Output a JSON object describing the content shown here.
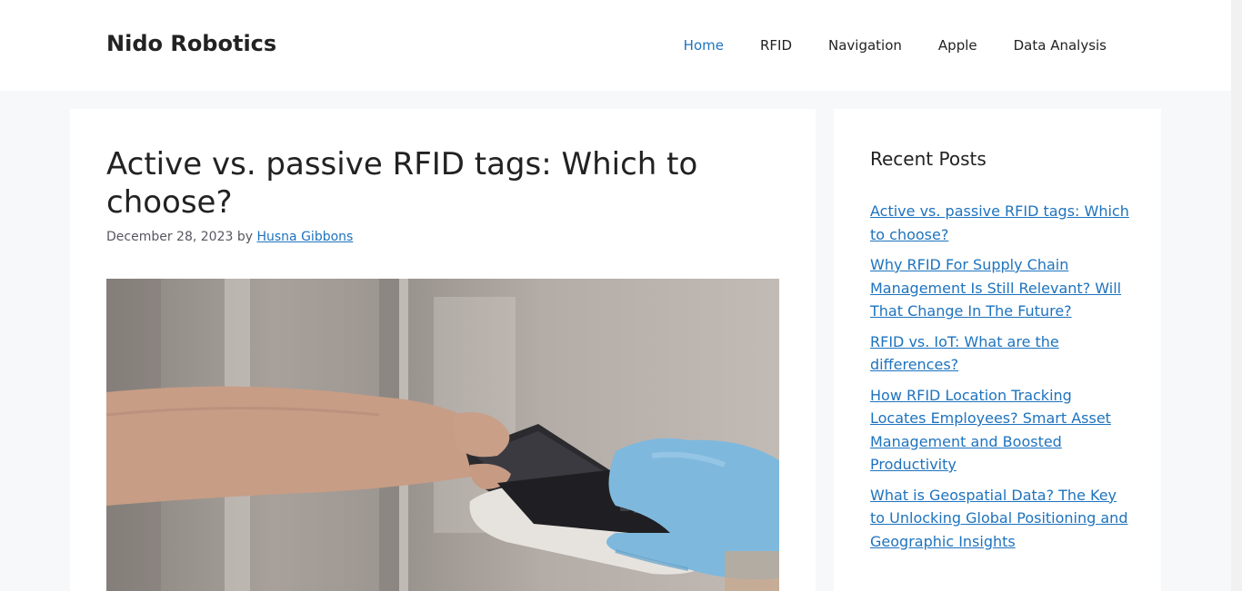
{
  "header": {
    "site_title": "Nido Robotics",
    "nav": [
      {
        "label": "Home",
        "active": true
      },
      {
        "label": "RFID",
        "active": false
      },
      {
        "label": "Navigation",
        "active": false
      },
      {
        "label": "Apple",
        "active": false
      },
      {
        "label": "Data Analysis",
        "active": false
      }
    ]
  },
  "post": {
    "title": "Active vs. passive RFID tags: Which to choose?",
    "date": "December 28, 2023",
    "by": "by",
    "author": "Husna Gibbons"
  },
  "sidebar": {
    "title": "Recent Posts",
    "posts": [
      "Active vs. passive RFID tags: Which to choose?",
      "Why RFID For Supply Chain Management Is Still Relevant? Will That Change In The Future?",
      "RFID vs. IoT: What are the differences?",
      "How RFID Location Tracking Locates Employees? Smart Asset Management and Boosted Productivity",
      "What is Geospatial Data? The Key to Unlocking Global Positioning and Geographic Insights"
    ]
  },
  "colors": {
    "accent": "#1e73be",
    "page_background": "#f7f8f9",
    "text": "#222222"
  }
}
